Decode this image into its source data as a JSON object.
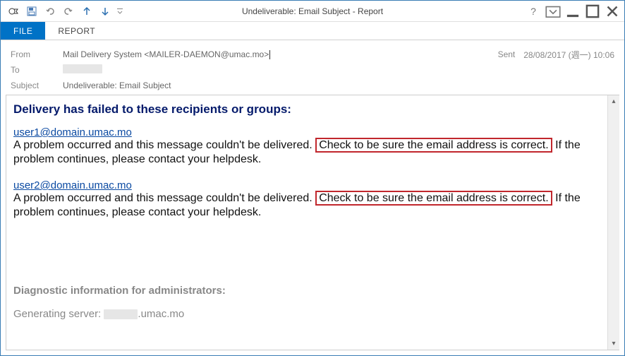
{
  "window": {
    "title": "Undeliverable: Email Subject - Report"
  },
  "ribbon": {
    "file_label": "FILE",
    "report_label": "REPORT"
  },
  "headers": {
    "from_label": "From",
    "from_value": "Mail Delivery System <MAILER-DAEMON@umac.mo>",
    "to_label": "To",
    "subject_label": "Subject",
    "subject_value": "Undeliverable: Email Subject",
    "sent_label": "Sent",
    "sent_value": "28/08/2017 (週一) 10:06"
  },
  "body": {
    "heading": "Delivery has failed to these recipients or groups:",
    "failures": [
      {
        "email": "user1@domain.umac.mo",
        "msg_before": "A problem occurred and this message couldn't be delivered.",
        "msg_highlight": "Check to be sure the email address is correct.",
        "msg_after": "If the problem continues, please contact your helpdesk."
      },
      {
        "email": "user2@domain.umac.mo",
        "msg_before": "A problem occurred and this message couldn't be delivered.",
        "msg_highlight": "Check to be sure the email address is correct.",
        "msg_after": "If the problem continues, please contact your helpdesk."
      }
    ],
    "diag_heading": "Diagnostic information for administrators:",
    "diag_server_label": "Generating server:",
    "diag_server_suffix": ".umac.mo"
  }
}
